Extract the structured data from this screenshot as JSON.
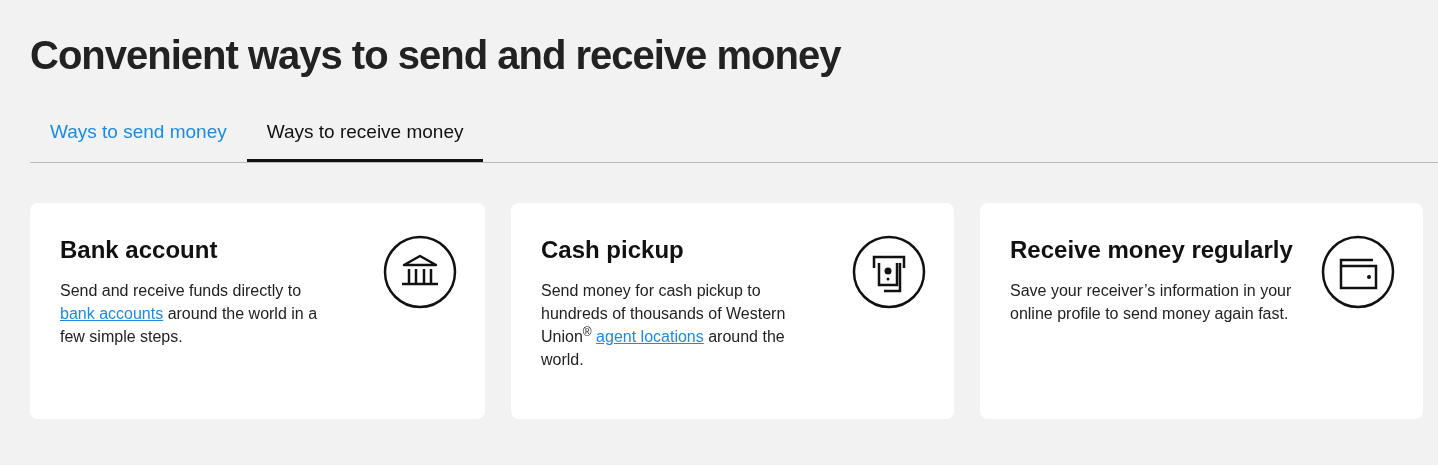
{
  "title": "Convenient ways to send and receive money",
  "tabs": [
    {
      "label": "Ways to send money",
      "selected": false
    },
    {
      "label": "Ways to receive money",
      "selected": true
    }
  ],
  "cards": [
    {
      "heading": "Bank account",
      "body": [
        {
          "kind": "text",
          "text": "Send and receive funds directly to "
        },
        {
          "kind": "link",
          "text": "bank accounts"
        },
        {
          "kind": "text",
          "text": " around the world in a few simple steps."
        }
      ]
    },
    {
      "heading": "Cash pickup",
      "body": [
        {
          "kind": "text",
          "text": "Send money for cash pickup to hundreds of thousands of Western Union$^{®}$ "
        },
        {
          "kind": "link",
          "text": "agent locations"
        },
        {
          "kind": "text",
          "text": " around the world."
        }
      ]
    },
    {
      "heading": "Receive money regularly",
      "body": [
        {
          "kind": "text",
          "text": "Save your receiver’s information in your online profile to send money again fast."
        }
      ]
    }
  ]
}
